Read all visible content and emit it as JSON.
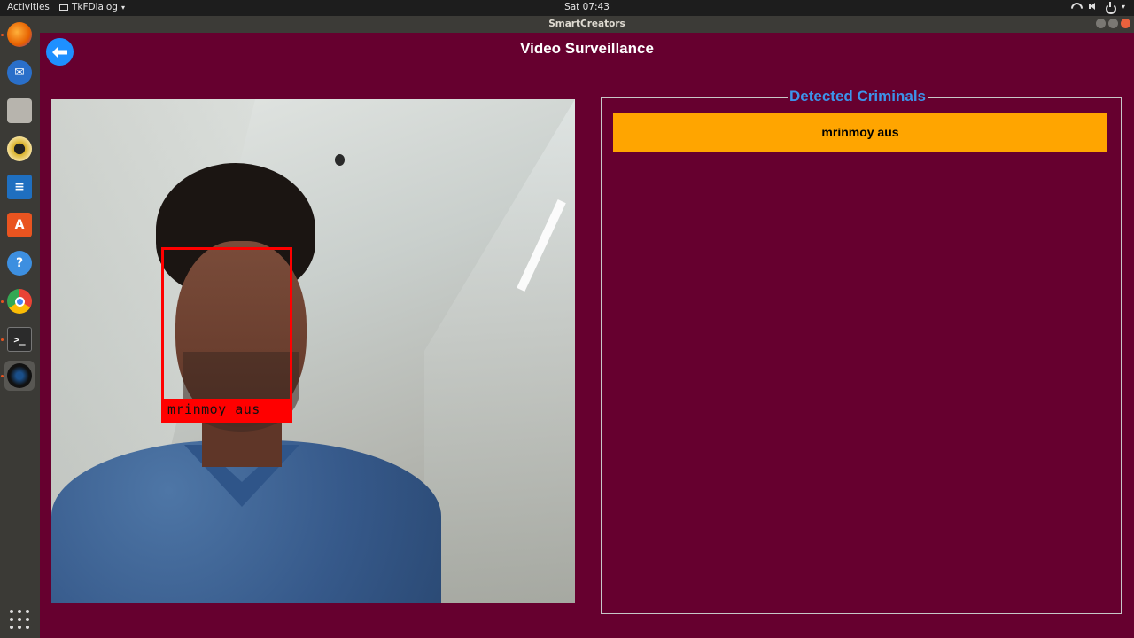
{
  "system": {
    "activities_label": "Activities",
    "app_menu_label": "TkFDialog",
    "clock": "Sat 07:43"
  },
  "window": {
    "title": "SmartCreators"
  },
  "dock": {
    "items": [
      {
        "name": "firefox",
        "color": "#e66000"
      },
      {
        "name": "thunderbird",
        "color": "#2a6fc9"
      },
      {
        "name": "files",
        "color": "#b7b4ad"
      },
      {
        "name": "rhythmbox",
        "color": "#d9b12a"
      },
      {
        "name": "libreoffice-writer",
        "color": "#1f6fc0"
      },
      {
        "name": "software-center",
        "color": "#e95420"
      },
      {
        "name": "help",
        "color": "#3d8fe0"
      },
      {
        "name": "chrome",
        "color": "#34a853"
      },
      {
        "name": "terminal",
        "color": "#2b2b2b"
      },
      {
        "name": "smartcreators-app",
        "color": "#111111"
      }
    ]
  },
  "app": {
    "page_title": "Video Surveillance",
    "detection_label": "mrinmoy aus",
    "panel_title": "Detected Criminals",
    "criminals": [
      "mrinmoy aus"
    ]
  },
  "colors": {
    "background": "#66002f",
    "accent_blue": "#3c93ea",
    "item_orange": "#ffa500",
    "detection_red": "#ff0000"
  }
}
